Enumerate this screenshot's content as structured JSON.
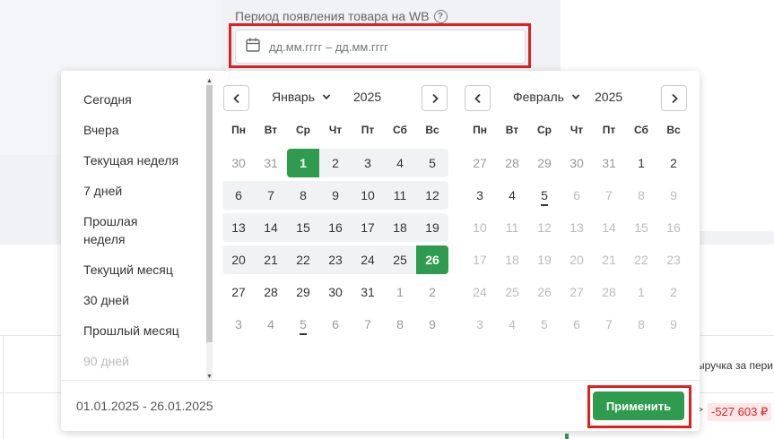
{
  "field": {
    "label": "Период появления товара на WB",
    "help": "?",
    "placeholder": "дд.мм.гггг – дд.мм.гггг"
  },
  "background": {
    "column_header": "ыручка за пери",
    "negative_value": "-527 603 ₽",
    "arrow": ">"
  },
  "presets": [
    {
      "label": "Сегодня"
    },
    {
      "label": "Вчера"
    },
    {
      "label": "Текущая неделя"
    },
    {
      "label": "7 дней"
    },
    {
      "label": "Прошлая неделя"
    },
    {
      "label": "Текущий месяц"
    },
    {
      "label": "30 дней"
    },
    {
      "label": "Прошлый месяц"
    },
    {
      "label": "90 дней"
    }
  ],
  "weekdays": [
    "Пн",
    "Вт",
    "Ср",
    "Чт",
    "Пт",
    "Сб",
    "Вс"
  ],
  "calendars": [
    {
      "month": "Январь",
      "year": "2025",
      "weeks": [
        [
          {
            "d": "30",
            "t": "other"
          },
          {
            "d": "31",
            "t": "other"
          },
          {
            "d": "1",
            "t": "sel-start"
          },
          {
            "d": "2",
            "t": "range"
          },
          {
            "d": "3",
            "t": "range"
          },
          {
            "d": "4",
            "t": "range"
          },
          {
            "d": "5",
            "t": "range"
          }
        ],
        [
          {
            "d": "6",
            "t": "range"
          },
          {
            "d": "7",
            "t": "range"
          },
          {
            "d": "8",
            "t": "range"
          },
          {
            "d": "9",
            "t": "range"
          },
          {
            "d": "10",
            "t": "range"
          },
          {
            "d": "11",
            "t": "range"
          },
          {
            "d": "12",
            "t": "range"
          }
        ],
        [
          {
            "d": "13",
            "t": "range"
          },
          {
            "d": "14",
            "t": "range"
          },
          {
            "d": "15",
            "t": "range"
          },
          {
            "d": "16",
            "t": "range"
          },
          {
            "d": "17",
            "t": "range"
          },
          {
            "d": "18",
            "t": "range"
          },
          {
            "d": "19",
            "t": "range"
          }
        ],
        [
          {
            "d": "20",
            "t": "range"
          },
          {
            "d": "21",
            "t": "range"
          },
          {
            "d": "22",
            "t": "range"
          },
          {
            "d": "23",
            "t": "range"
          },
          {
            "d": "24",
            "t": "range"
          },
          {
            "d": "25",
            "t": "range"
          },
          {
            "d": "26",
            "t": "sel-end"
          }
        ],
        [
          {
            "d": "27",
            "t": "normal"
          },
          {
            "d": "28",
            "t": "normal"
          },
          {
            "d": "29",
            "t": "normal"
          },
          {
            "d": "30",
            "t": "normal"
          },
          {
            "d": "31",
            "t": "normal"
          },
          {
            "d": "1",
            "t": "other"
          },
          {
            "d": "2",
            "t": "other"
          }
        ],
        [
          {
            "d": "3",
            "t": "other"
          },
          {
            "d": "4",
            "t": "other"
          },
          {
            "d": "5",
            "t": "other-today"
          },
          {
            "d": "6",
            "t": "other"
          },
          {
            "d": "7",
            "t": "other"
          },
          {
            "d": "8",
            "t": "other"
          },
          {
            "d": "9",
            "t": "other"
          }
        ]
      ]
    },
    {
      "month": "Февраль",
      "year": "2025",
      "weeks": [
        [
          {
            "d": "27",
            "t": "other"
          },
          {
            "d": "28",
            "t": "other"
          },
          {
            "d": "29",
            "t": "other"
          },
          {
            "d": "30",
            "t": "other"
          },
          {
            "d": "31",
            "t": "other"
          },
          {
            "d": "1",
            "t": "normal"
          },
          {
            "d": "2",
            "t": "normal"
          }
        ],
        [
          {
            "d": "3",
            "t": "normal"
          },
          {
            "d": "4",
            "t": "normal"
          },
          {
            "d": "5",
            "t": "today"
          },
          {
            "d": "6",
            "t": "disabled"
          },
          {
            "d": "7",
            "t": "disabled"
          },
          {
            "d": "8",
            "t": "disabled"
          },
          {
            "d": "9",
            "t": "disabled"
          }
        ],
        [
          {
            "d": "10",
            "t": "disabled"
          },
          {
            "d": "11",
            "t": "disabled"
          },
          {
            "d": "12",
            "t": "disabled"
          },
          {
            "d": "13",
            "t": "disabled"
          },
          {
            "d": "14",
            "t": "disabled"
          },
          {
            "d": "15",
            "t": "disabled"
          },
          {
            "d": "16",
            "t": "disabled"
          }
        ],
        [
          {
            "d": "17",
            "t": "disabled"
          },
          {
            "d": "18",
            "t": "disabled"
          },
          {
            "d": "19",
            "t": "disabled"
          },
          {
            "d": "20",
            "t": "disabled"
          },
          {
            "d": "21",
            "t": "disabled"
          },
          {
            "d": "22",
            "t": "disabled"
          },
          {
            "d": "23",
            "t": "disabled"
          }
        ],
        [
          {
            "d": "24",
            "t": "disabled"
          },
          {
            "d": "25",
            "t": "disabled"
          },
          {
            "d": "26",
            "t": "disabled"
          },
          {
            "d": "27",
            "t": "disabled"
          },
          {
            "d": "28",
            "t": "disabled"
          },
          {
            "d": "1",
            "t": "disabled"
          },
          {
            "d": "2",
            "t": "disabled"
          }
        ],
        [
          {
            "d": "3",
            "t": "disabled"
          },
          {
            "d": "4",
            "t": "disabled"
          },
          {
            "d": "5",
            "t": "disabled"
          },
          {
            "d": "6",
            "t": "disabled"
          },
          {
            "d": "7",
            "t": "disabled"
          },
          {
            "d": "8",
            "t": "disabled"
          },
          {
            "d": "9",
            "t": "disabled"
          }
        ]
      ]
    }
  ],
  "footer": {
    "selected_range": "01.01.2025 - 26.01.2025",
    "apply_label": "Применить"
  },
  "colors": {
    "accent": "#2e9b4f",
    "highlight_frame": "#e0201f",
    "range_bg": "#f1f2f4",
    "negative": "#d9232d"
  },
  "icons": {
    "calendar": "calendar-icon",
    "prev": "chevron-left-icon",
    "next": "chevron-right-icon",
    "dropdown": "chevron-down-icon",
    "help": "help-circle-icon"
  }
}
